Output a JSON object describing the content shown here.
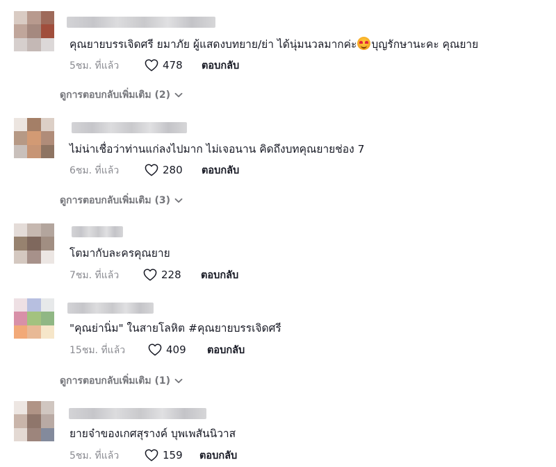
{
  "comments": [
    {
      "text_before": "คุณยายบรรเจิดศรี ยมาภัย ผู้แสดงบทยาย/ย่า ได้นุ่มนวลมากค่ะ",
      "emoji_icon": "smiling-face-with-heart-eyes-icon",
      "text_after": "บุญรักษานะคะ คุณยาย",
      "time": "5ชม. ที่แล้ว",
      "likes": "478",
      "reply_label": "ตอบกลับ"
    },
    {
      "text": "ไม่น่าเชื่อว่าท่านแก่ลงไปมาก ไม่เจอนาน คิดถึงบทคุณยายช่อง 7",
      "time": "6ชม. ที่แล้ว",
      "likes": "280",
      "reply_label": "ตอบกลับ"
    },
    {
      "text": "โตมากับละครคุณยาย",
      "time": "7ชม. ที่แล้ว",
      "likes": "228",
      "reply_label": "ตอบกลับ"
    },
    {
      "text": "\"คุณย่านิ่ม\" ในสายโลหิต #คุณยายบรรเจิดศรี",
      "time": "15ชม. ที่แล้ว",
      "likes": "409",
      "reply_label": "ตอบกลับ"
    },
    {
      "text": "ยายจ๋าของเกศสุรางค์ บุพเพสันนิวาส",
      "time": "5ชม. ที่แล้ว",
      "likes": "159",
      "reply_label": "ตอบกลับ"
    }
  ],
  "more_replies": [
    "ดูการตอบกลับเพิ่มเติม (2)",
    "ดูการตอบกลับเพิ่มเติม (3)",
    "ดูการตอบกลับเพิ่มเติม (1)"
  ]
}
